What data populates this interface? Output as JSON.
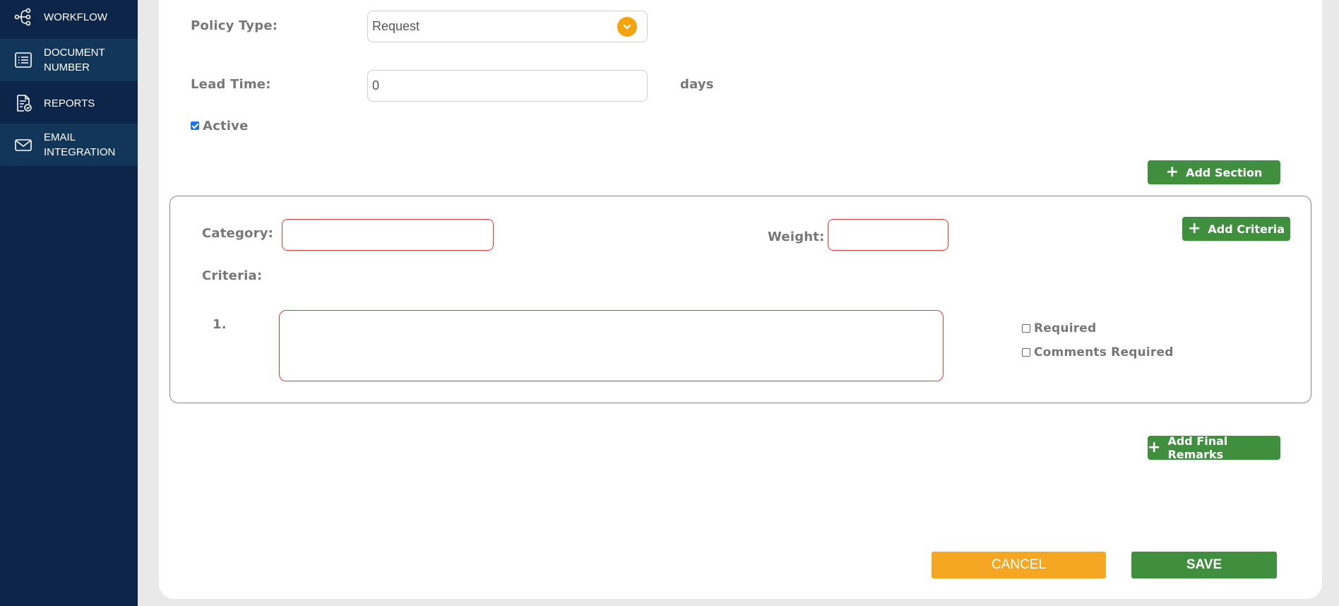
{
  "sidebar": {
    "items": [
      {
        "label_line1": "WORKFLOW",
        "label_line2": "",
        "icon": "workflow-icon"
      },
      {
        "label_line1": "DOCUMENT",
        "label_line2": "NUMBER",
        "icon": "document-list-icon"
      },
      {
        "label_line1": "REPORTS",
        "label_line2": "",
        "icon": "report-check-icon"
      },
      {
        "label_line1": "EMAIL",
        "label_line2": "INTEGRATION",
        "icon": "envelope-icon"
      }
    ]
  },
  "form": {
    "policy_type_label": "Policy Type:",
    "policy_type_value": "Request",
    "lead_time_label": "Lead Time:",
    "lead_time_value": "0",
    "lead_time_unit": "days",
    "active_label": "Active",
    "active_checked": true,
    "add_section_label": "Add Section"
  },
  "section": {
    "category_label": "Category:",
    "weight_label": "Weight:",
    "add_criteria_label": "Add Criteria",
    "criteria_label": "Criteria:",
    "criteria_items": [
      {
        "number": "1.",
        "text": "",
        "required_label": "Required",
        "comments_required_label": "Comments Required"
      }
    ]
  },
  "actions": {
    "add_final_remarks_label": "Add Final Remarks",
    "cancel_label": "CANCEL",
    "save_label": "SAVE"
  },
  "colors": {
    "sidebar_bg": "#0c2548",
    "accent_orange": "#f5a623",
    "accent_green": "#3f8f3f",
    "error_border": "#e53935"
  }
}
